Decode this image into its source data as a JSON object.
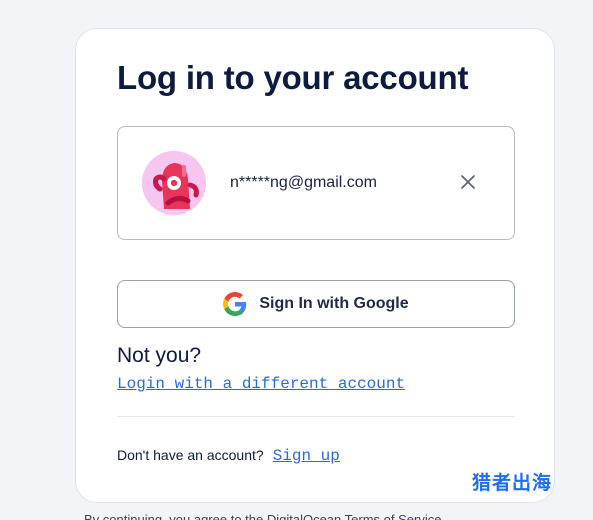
{
  "login": {
    "title": "Log in to your account",
    "account": {
      "email": "n*****ng@gmail.com"
    },
    "google_button_label": "Sign In with Google",
    "not_you": "Not you?",
    "different_account_link": "Login with a different account",
    "signup_prompt": "Don't have an account?",
    "signup_link": "Sign up"
  },
  "footer": {
    "text_partial": "By continuing, you agree to the DigitalOcean",
    "link_partial": "Terms of Service"
  },
  "watermark": "猎者出海",
  "icons": {
    "avatar": "avatar",
    "close": "close-icon",
    "google": "google-icon"
  },
  "colors": {
    "accent_link": "#2a6bd8",
    "title": "#0d1b3e",
    "avatar_bg": "#f7c6ee",
    "avatar_fg": "#e8335a",
    "watermark": "#1e6ef0"
  }
}
